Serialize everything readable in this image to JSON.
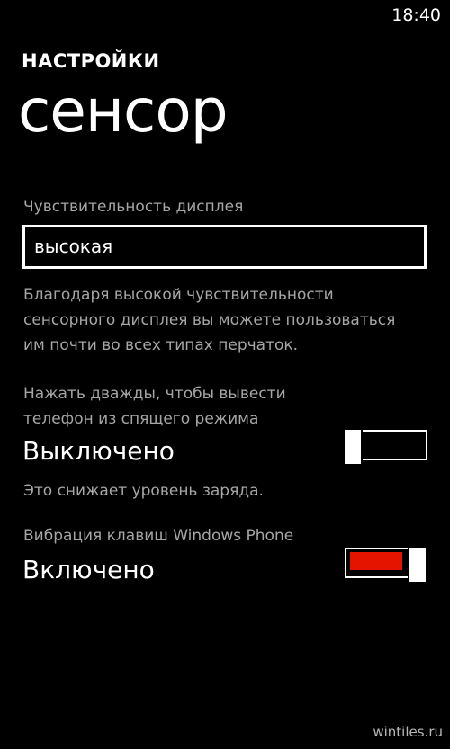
{
  "status_bar": {
    "time": "18:40"
  },
  "header": {
    "app_title": "НАСТРОЙКИ",
    "page_title": "сенсор"
  },
  "sensitivity": {
    "label": "Чувствительность дисплея",
    "selected_value": "высокая",
    "description_lines": [
      "Благодаря высокой чувствительности",
      "сенсорного дисплея вы можете пользоваться",
      "им почти во всех типах перчаток."
    ]
  },
  "double_tap": {
    "label_lines": [
      "Нажать дважды, чтобы вывести",
      "телефон из спящего режима"
    ],
    "state_text": "Выключено",
    "is_on": false,
    "note": "Это снижает уровень заряда."
  },
  "vibration": {
    "label": "Вибрация клавиш Windows Phone",
    "state_text": "Включено",
    "is_on": true
  },
  "watermark": "wintiles.ru",
  "colors": {
    "background": "#000000",
    "foreground": "#ffffff",
    "secondary_text": "#a6a6a6",
    "accent": "#e51400"
  }
}
